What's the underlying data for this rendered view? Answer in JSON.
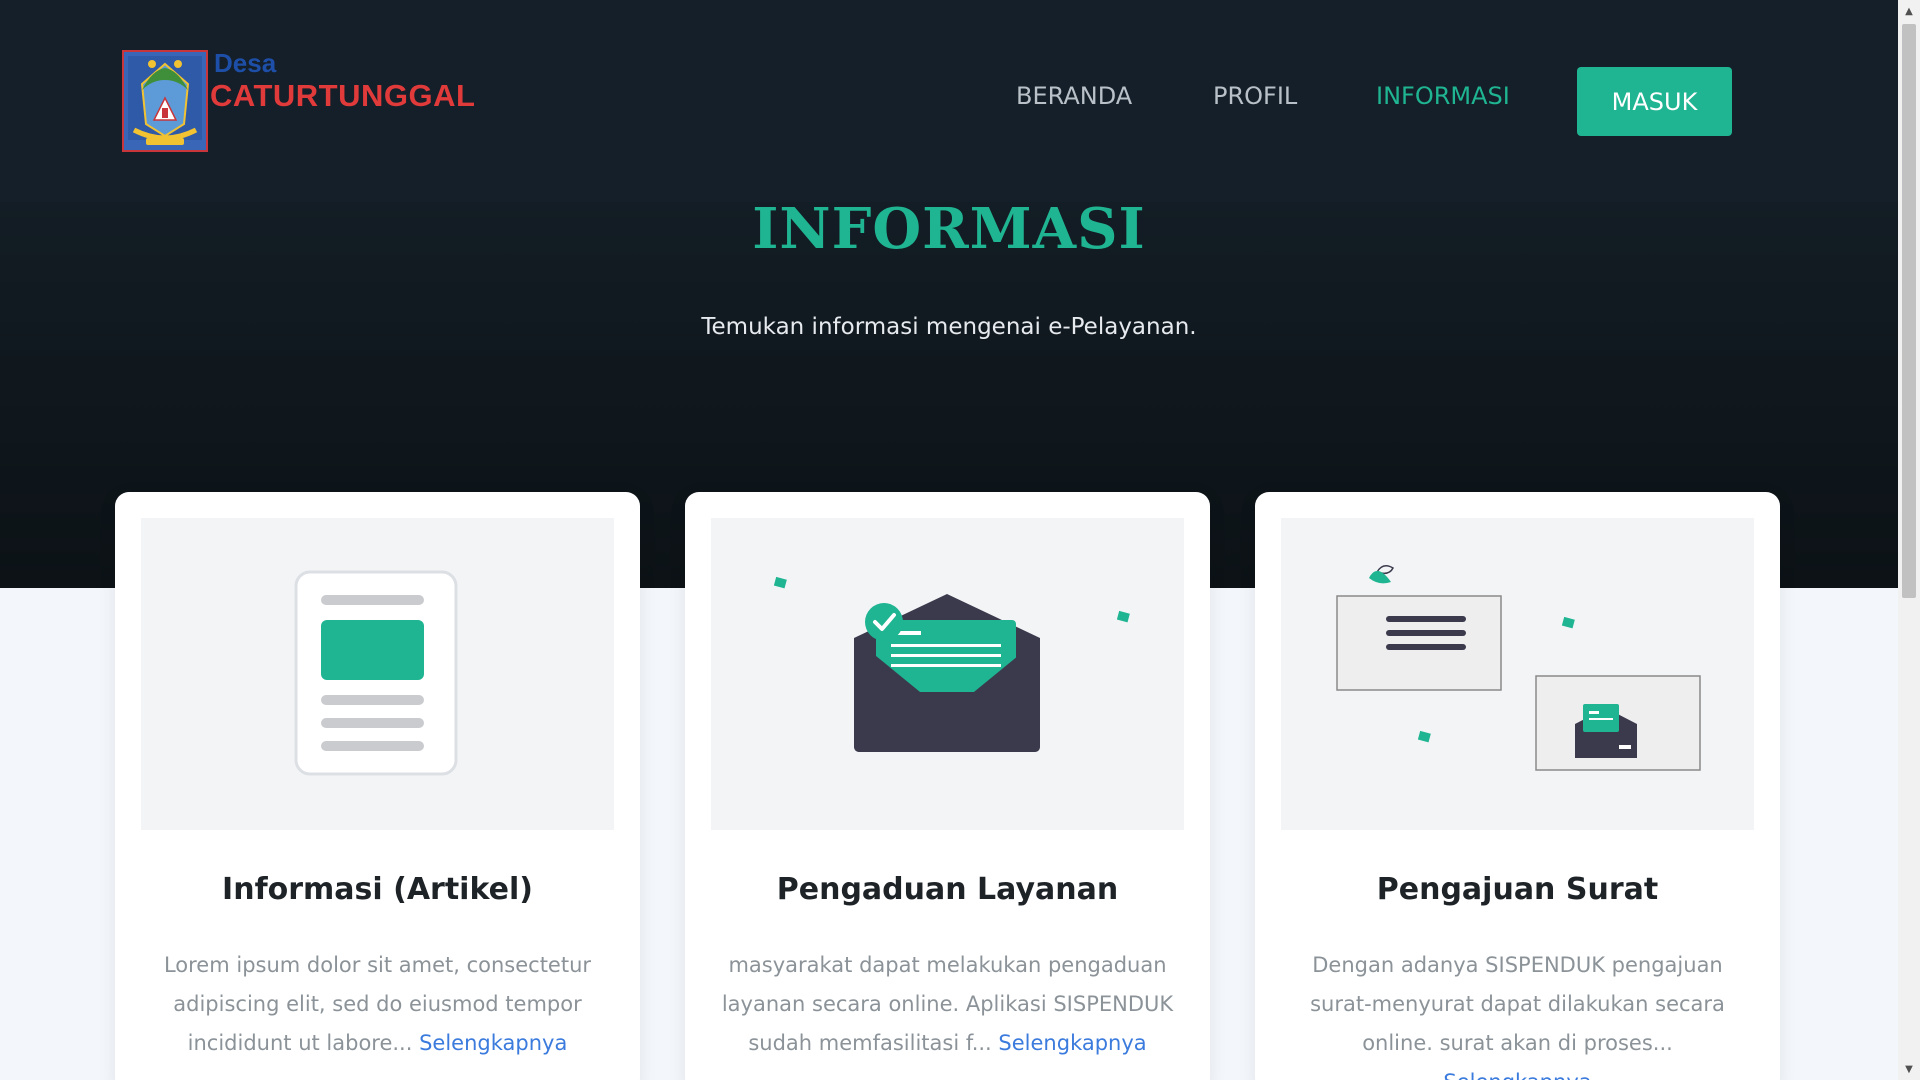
{
  "header": {
    "brand_desa": "Desa",
    "brand_name": "CATURTUNGGAL",
    "logo_icon": "village-emblem-logo",
    "nav": [
      {
        "label": "BERANDA",
        "active": false
      },
      {
        "label": "PROFIL",
        "active": false
      },
      {
        "label": "INFORMASI",
        "active": true
      }
    ],
    "login_label": "MASUK"
  },
  "hero": {
    "title": "INFORMASI",
    "subtitle": "Temukan informasi mengenai e-Pelayanan."
  },
  "cards": [
    {
      "title": "Informasi (Artikel)",
      "text": "Lorem ipsum dolor sit amet, consectetur adipiscing elit, sed do eiusmod tempor incididunt ut labore...",
      "link": "Selengkapnya",
      "icon": "document-icon"
    },
    {
      "title": "Pengaduan Layanan",
      "text": "masyarakat dapat melakukan pengaduan layanan secara online. Aplikasi SISPENDUK sudah memfasilitasi f...",
      "link": "Selengkapnya",
      "icon": "envelope-letter-icon"
    },
    {
      "title": "Pengajuan Surat",
      "text": "Dengan adanya SISPENDUK pengajuan surat-menyurat dapat dilakukan secara online. surat akan di proses...",
      "link": "Selengkapnya",
      "icon": "mail-windows-icon"
    }
  ],
  "colors": {
    "accent": "#1fb592",
    "header_bg": "#141f29",
    "hero_bg": "#0f171d",
    "page_bg": "#f3f7fb",
    "link": "#3b7bdd",
    "brand_blue": "#1e4fa8",
    "brand_red": "#e03a3a"
  }
}
